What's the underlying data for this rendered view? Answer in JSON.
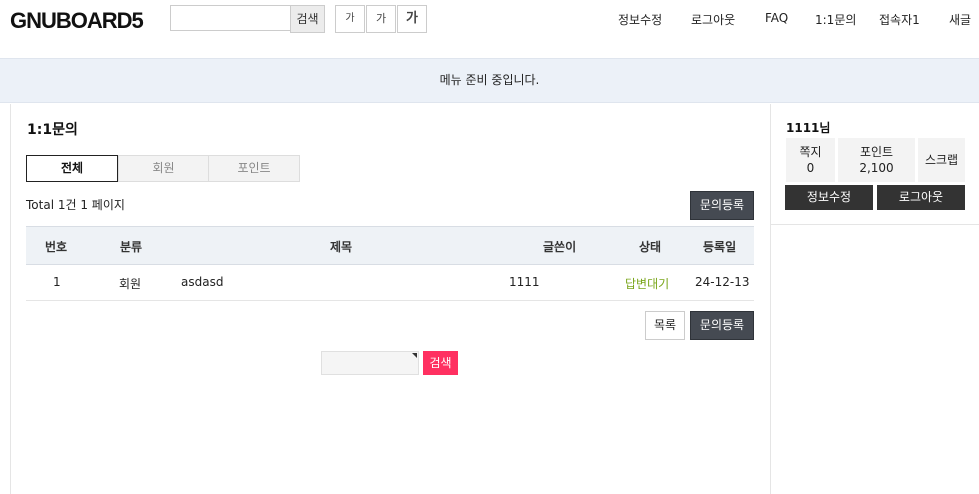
{
  "header": {
    "logo": "GNUBOARD5",
    "search_button": "검색",
    "font_sizes": [
      "가",
      "가",
      "가"
    ],
    "nav": [
      "정보수정",
      "로그아웃",
      "FAQ",
      "1:1문의",
      "접속자1",
      "새글"
    ]
  },
  "banner": {
    "text": "메뉴 준비 중입니다."
  },
  "main": {
    "title": "1:1문의",
    "tabs": [
      "전체",
      "회원",
      "포인트"
    ],
    "total": "Total 1건 1 페이지",
    "register_button": "문의등록",
    "list_button": "목록",
    "table": {
      "headers": [
        "번호",
        "분류",
        "제목",
        "글쓴이",
        "상태",
        "등록일"
      ],
      "rows": [
        {
          "num": "1",
          "category": "회원",
          "subject": "asdasd",
          "writer": "1111",
          "status": "답변대기",
          "date": "24-12-13"
        }
      ]
    },
    "search_button": "검색"
  },
  "sidebar": {
    "name": "1111님",
    "memo_label": "쪽지",
    "memo_count": "0",
    "point_label": "포인트",
    "point_value": "2,100",
    "scrap_label": "스크랩",
    "edit_button": "정보수정",
    "logout_button": "로그아웃"
  },
  "colors": {
    "status_waiting": "#7aa61b",
    "search_accent": "#ff3061",
    "banner_bg": "#ecf1f8",
    "dark_button": "#454a52"
  }
}
